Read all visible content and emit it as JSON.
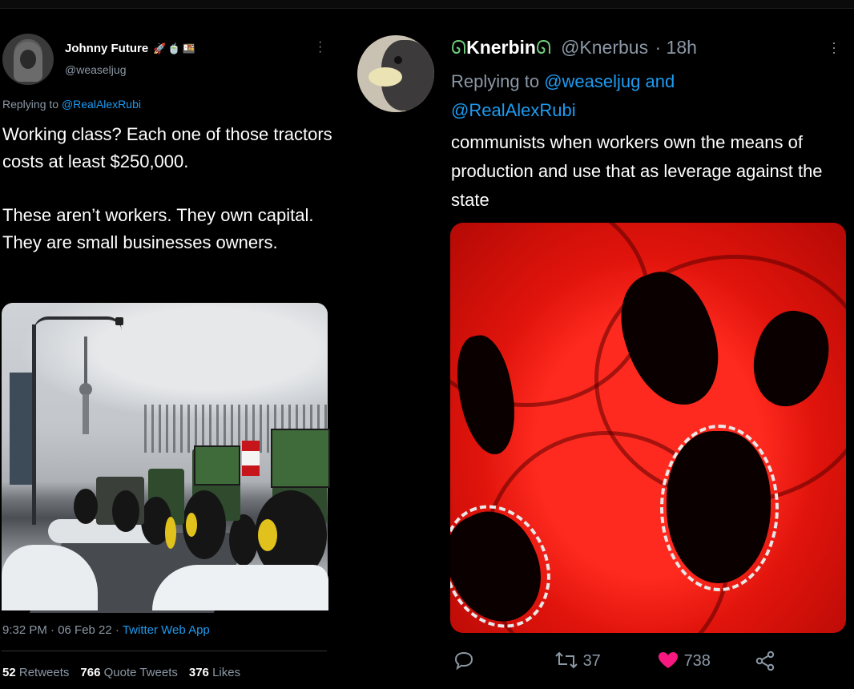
{
  "left_tweet": {
    "author_name": "Johnny Future",
    "author_emojis": "🚀🍵🍱",
    "handle": "@weaseljug",
    "reply_prefix": "Replying to",
    "reply_to": "@RealAlexRubi",
    "paragraphs": [
      "Working class?  Each one of those tractors costs at least $250,000.",
      "These aren’t workers.  They own capital.  They are small businesses owners."
    ],
    "timestamp": "9:32 PM · 06 Feb 22 · ",
    "client": "Twitter Web App",
    "stats": {
      "retweets_count": "52",
      "retweets_label": "Retweets",
      "quotes_count": "766",
      "quotes_label": "Quote Tweets",
      "likes_count": "376",
      "likes_label": "Likes"
    }
  },
  "right_tweet": {
    "author_name": "Knerbin",
    "name_icon": "ᘏ",
    "handle": "@Knerbus",
    "time": "· 18h",
    "reply_prefix": "Replying to",
    "reply_to_1": "@weaseljug",
    "reply_and": "and",
    "reply_to_2": "@RealAlexRubi",
    "text": "communists when workers own the means of production and use that as leverage against the state",
    "actions": {
      "reply_icon": "speech-bubble-icon",
      "retweets": "37",
      "likes": "738",
      "share_icon": "share-icon"
    }
  },
  "colors": {
    "background": "#000000",
    "text": "#e7e9ea",
    "secondary": "#8b98a5",
    "link": "#1d9bf0",
    "like": "#f91880"
  }
}
